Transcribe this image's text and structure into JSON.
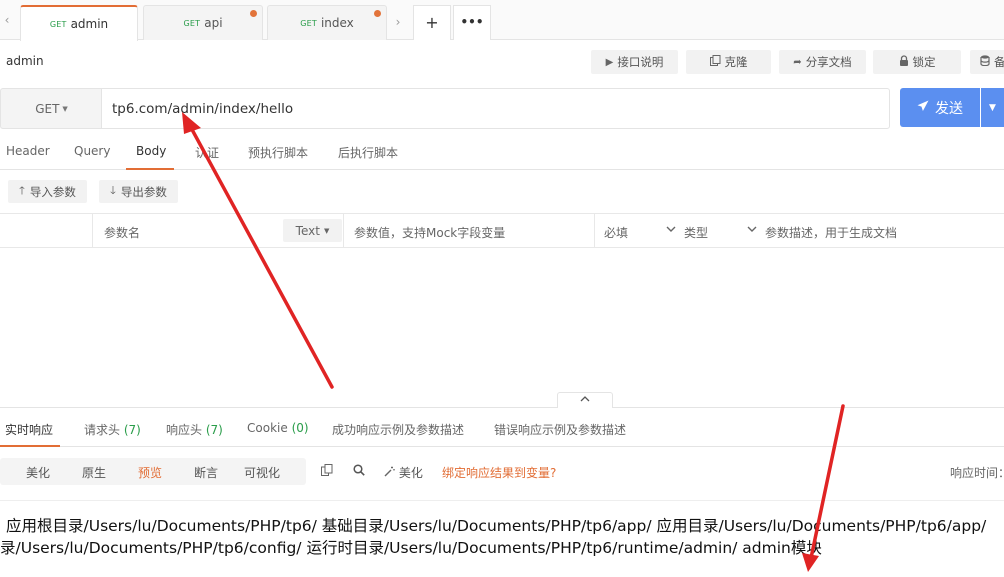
{
  "tabs": [
    {
      "method": "GET",
      "name": "admin",
      "active": true,
      "modified": false
    },
    {
      "method": "GET",
      "name": "api",
      "active": false,
      "modified": true
    },
    {
      "method": "GET",
      "name": "index",
      "active": false,
      "modified": true
    }
  ],
  "tab_controls": {
    "scroll_left": "‹",
    "scroll_right": "›",
    "add": "+",
    "more": "•••"
  },
  "api_title": "admin",
  "toolbar": {
    "doc_label": "接口说明",
    "clone_label": "克隆",
    "share_label": "分享文档",
    "lock_label": "锁定",
    "extra_label": "备"
  },
  "request": {
    "method": "GET",
    "url": "tp6.com/admin/index/hello",
    "send_label": "发送"
  },
  "request_tabs": [
    {
      "label": "Header",
      "active": false
    },
    {
      "label": "Query",
      "active": false
    },
    {
      "label": "Body",
      "active": true
    },
    {
      "label": "认证",
      "active": false
    },
    {
      "label": "预执行脚本",
      "active": false
    },
    {
      "label": "后执行脚本",
      "active": false
    }
  ],
  "body_actions": {
    "import_label": "导入参数",
    "export_label": "导出参数"
  },
  "param_row": {
    "name_placeholder": "参数名",
    "type_select": "Text",
    "value_placeholder": "参数值，支持Mock字段变量",
    "required": "必填",
    "type_label": "类型",
    "desc_placeholder": "参数描述，用于生成文档"
  },
  "response_tabs": [
    {
      "label": "实时响应",
      "count": "",
      "active": true
    },
    {
      "label": "请求头",
      "count": "(7)",
      "active": false
    },
    {
      "label": "响应头",
      "count": "(7)",
      "active": false
    },
    {
      "label": "Cookie",
      "count": "(0)",
      "active": false
    },
    {
      "label": "成功响应示例及参数描述",
      "count": "",
      "active": false
    },
    {
      "label": "错误响应示例及参数描述",
      "count": "",
      "active": false
    }
  ],
  "view_modes": [
    {
      "label": "美化",
      "active": false
    },
    {
      "label": "原生",
      "active": false
    },
    {
      "label": "预览",
      "active": true
    },
    {
      "label": "断言",
      "active": false
    },
    {
      "label": "可视化",
      "active": false
    }
  ],
  "response_tools": {
    "beautify_label": "美化",
    "bind_link": "绑定响应结果到变量?",
    "time_label": "响应时间："
  },
  "response_body": {
    "line1": "应用根目录/Users/lu/Documents/PHP/tp6/ 基础目录/Users/lu/Documents/PHP/tp6/app/ 应用目录/Users/lu/Documents/PHP/tp6/app/",
    "line2": "录/Users/lu/Documents/PHP/tp6/config/ 运行时目录/Users/lu/Documents/PHP/tp6/runtime/admin/ admin模块"
  },
  "colors": {
    "accent": "#e26d35",
    "primary": "#5b8ff0",
    "method_green": "#2a9d4a",
    "annotation_arrow": "#e02424"
  }
}
